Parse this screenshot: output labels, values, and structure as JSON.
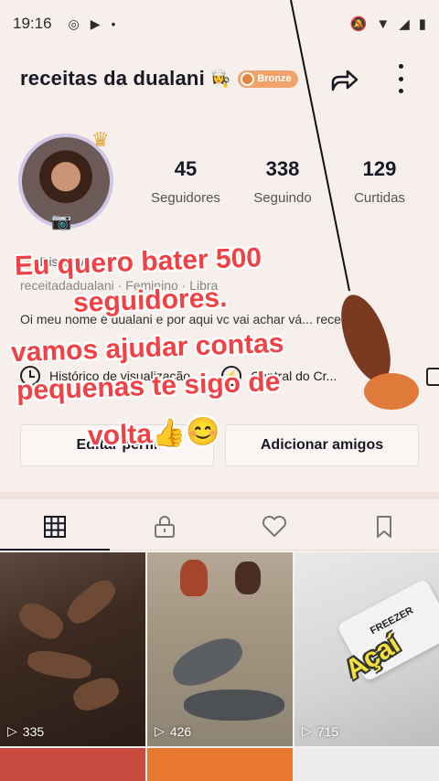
{
  "status_bar": {
    "time": "19:16"
  },
  "header": {
    "username": "receitas  da dualani",
    "badge_label": "Bronze"
  },
  "profile": {
    "stats": [
      {
        "value": "45",
        "label": "Seguidores"
      },
      {
        "value": "338",
        "label": "Seguindo"
      },
      {
        "value": "129",
        "label": "Curtidas"
      }
    ],
    "category": "Distintivos",
    "meta": "receitadadualani  ·  Feminino  ·  Libra",
    "bio": "Oi meu nome é dualani e por aqui vc vai achar vá... receitas 👩‍🍳"
  },
  "links": {
    "history": "Histórico de visualização",
    "creator_center": "Central do Cr..."
  },
  "buttons": {
    "edit_profile": "Editar perfil",
    "add_friends": "Adicionar amigos"
  },
  "overlay": {
    "line1": "Eu quero bater 500",
    "line2": "seguidores.",
    "line3": "vamos ajudar contas",
    "line4": "pequenas te sigo de",
    "line5": "volta👍😊"
  },
  "videos": [
    {
      "views": "335"
    },
    {
      "views": "426"
    },
    {
      "views": "715",
      "caption": "Açaí",
      "product_label": "FREEZER"
    }
  ]
}
